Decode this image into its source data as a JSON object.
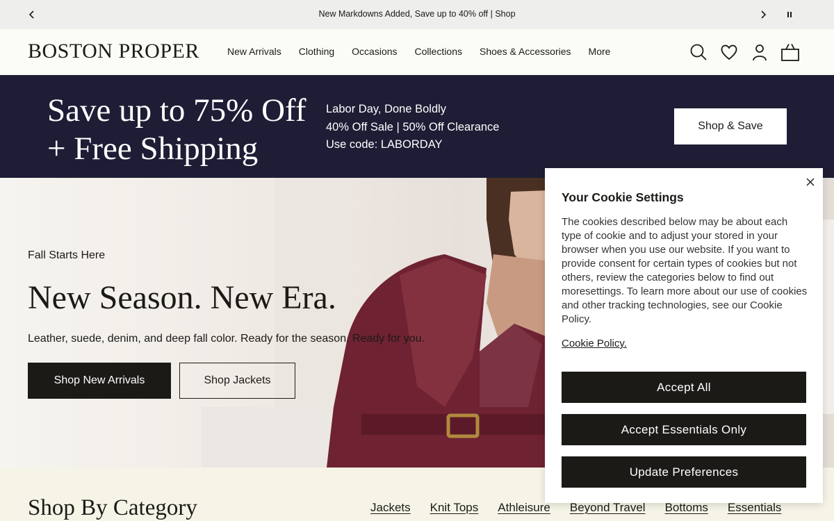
{
  "announcement": {
    "message": "New Markdowns Added, Save up to 40% off | Shop"
  },
  "header": {
    "logo": "BOSTON PROPER",
    "nav": [
      "New Arrivals",
      "Clothing",
      "Occasions",
      "Collections",
      "Shoes & Accessories",
      "More"
    ]
  },
  "promo": {
    "headline_line1": "Save up to 75% Off",
    "headline_line2": "+ Free Shipping",
    "sub_line1": "Labor Day, Done Boldly",
    "sub_line2": "40% Off Sale | 50% Off Clearance",
    "sub_line3": "Use code: LABORDAY",
    "button": "Shop & Save"
  },
  "hero": {
    "tagline": "Fall Starts Here",
    "title": "New Season. New Era.",
    "description": "Leather, suede, denim, and deep fall color. Ready for the season. Ready for you.",
    "primary_button": "Shop New Arrivals",
    "secondary_button": "Shop Jackets"
  },
  "category": {
    "heading": "Shop By Category",
    "links": [
      "Jackets",
      "Knit Tops",
      "Athleisure",
      "Beyond Travel",
      "Bottoms",
      "Essentials"
    ]
  },
  "cookie": {
    "title": "Your Cookie Settings",
    "body": "The cookies described below may be about each type of cookie and to adjust your stored in your browser when you use our website. If you want to provide consent for certain types of cookies but not others, review the categories below to find out moresettings. To learn more about our use of cookies and other tracking technologies, see our Cookie Policy.",
    "policy_link": "Cookie Policy.",
    "accept_all": "Accept All",
    "accept_essentials": "Accept Essentials Only",
    "update_preferences": "Update Preferences"
  },
  "colors": {
    "promo_bg": "#1e1d35",
    "dark_button": "#1c1a17",
    "category_bg": "#f5f4e6",
    "announce_bg": "#eeeeec"
  },
  "icons": [
    "chevron-left-icon",
    "chevron-right-icon",
    "pause-icon",
    "search-icon",
    "heart-icon",
    "user-icon",
    "bag-icon",
    "close-icon"
  ]
}
